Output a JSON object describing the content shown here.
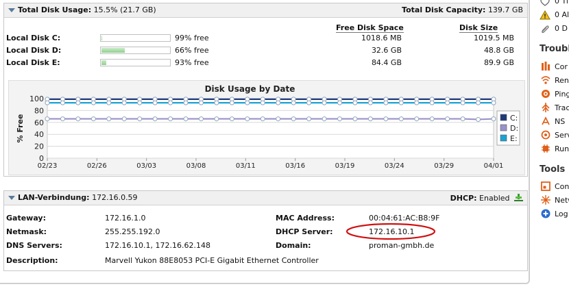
{
  "disk": {
    "title_label": "Total Disk Usage:",
    "title_value": "15.5% (21.7 GB)",
    "capacity_label": "Total Disk Capacity:",
    "capacity_value": "139.7 GB",
    "col_free": "Free Disk Space",
    "col_size": "Disk Size",
    "rows": [
      {
        "name": "Local Disk C:",
        "free_pct_label": "99% free",
        "used_fraction": 0.01,
        "free": "1018.6 MB",
        "size": "1019.5 MB"
      },
      {
        "name": "Local Disk D:",
        "free_pct_label": "66% free",
        "used_fraction": 0.34,
        "free": "32.6 GB",
        "size": "48.8 GB"
      },
      {
        "name": "Local Disk E:",
        "free_pct_label": "93% free",
        "used_fraction": 0.07,
        "free": "84.4 GB",
        "size": "89.9 GB"
      }
    ]
  },
  "chart_data": {
    "type": "line",
    "title": "Disk Usage by Date",
    "ylabel": "% Free",
    "xlabel": "",
    "ylim": [
      0,
      100
    ],
    "yticks": [
      "100",
      "80",
      "60",
      "40",
      "20",
      "0"
    ],
    "xticks": [
      "02/23",
      "02/26",
      "03/03",
      "03/08",
      "03/11",
      "03/16",
      "03/19",
      "03/24",
      "03/29",
      "04/01"
    ],
    "legend_position": "right",
    "grid": true,
    "series": [
      {
        "name": "C:",
        "color": "#1f3a7a",
        "values": [
          99,
          99,
          99,
          99,
          99,
          99,
          99,
          99,
          99,
          99,
          99,
          99,
          99,
          99,
          99,
          99,
          99,
          99,
          99,
          99,
          99,
          99,
          99,
          99,
          99,
          99,
          99,
          99,
          99,
          99
        ]
      },
      {
        "name": "D:",
        "color": "#9a92c8",
        "values": [
          66,
          66,
          66,
          66,
          66,
          66,
          66,
          66,
          66,
          66,
          66,
          66,
          66,
          66,
          66,
          66,
          66,
          66,
          66,
          66,
          66,
          66,
          66,
          66,
          66,
          66,
          66,
          66,
          65,
          66
        ]
      },
      {
        "name": "E:",
        "color": "#1aa3d4",
        "values": [
          93,
          93,
          93,
          93,
          93,
          93,
          93,
          93,
          93,
          93,
          93,
          93,
          93,
          93,
          93,
          93,
          93,
          93,
          93,
          93,
          93,
          93,
          93,
          93,
          93,
          93,
          93,
          93,
          93,
          93
        ]
      }
    ]
  },
  "lan": {
    "title_label": "LAN-Verbindung:",
    "title_value": "172.16.0.59",
    "dhcp_label": "DHCP:",
    "dhcp_value": "Enabled",
    "gateway_label": "Gateway:",
    "gateway_value": "172.16.1.0",
    "netmask_label": "Netmask:",
    "netmask_value": "255.255.192.0",
    "dns_label": "DNS Servers:",
    "dns_value": "172.16.10.1, 172.16.62.148",
    "desc_label": "Description:",
    "desc_value": "Marvell Yukon 88E8053 PCI-E Gigabit Ethernet Controller",
    "mac_label": "MAC Address:",
    "mac_value": "00:04:61:AC:B8:9F",
    "dhcp_server_label": "DHCP Server:",
    "dhcp_server_value": "172.16.10.1",
    "domain_label": "Domain:",
    "domain_value": "proman-gmbh.de"
  },
  "sidebar": {
    "top_items": [
      "0 Ti",
      "0 Al",
      "0 D"
    ],
    "troubleshoot_title": "Troubl",
    "troubleshoot_items": [
      "Cor",
      "Ren",
      "Ping",
      "Trac",
      "NS",
      "Serv",
      "Run"
    ],
    "tools_title": "Tools",
    "tools_items": [
      "Con",
      "Netw",
      "Log"
    ]
  }
}
